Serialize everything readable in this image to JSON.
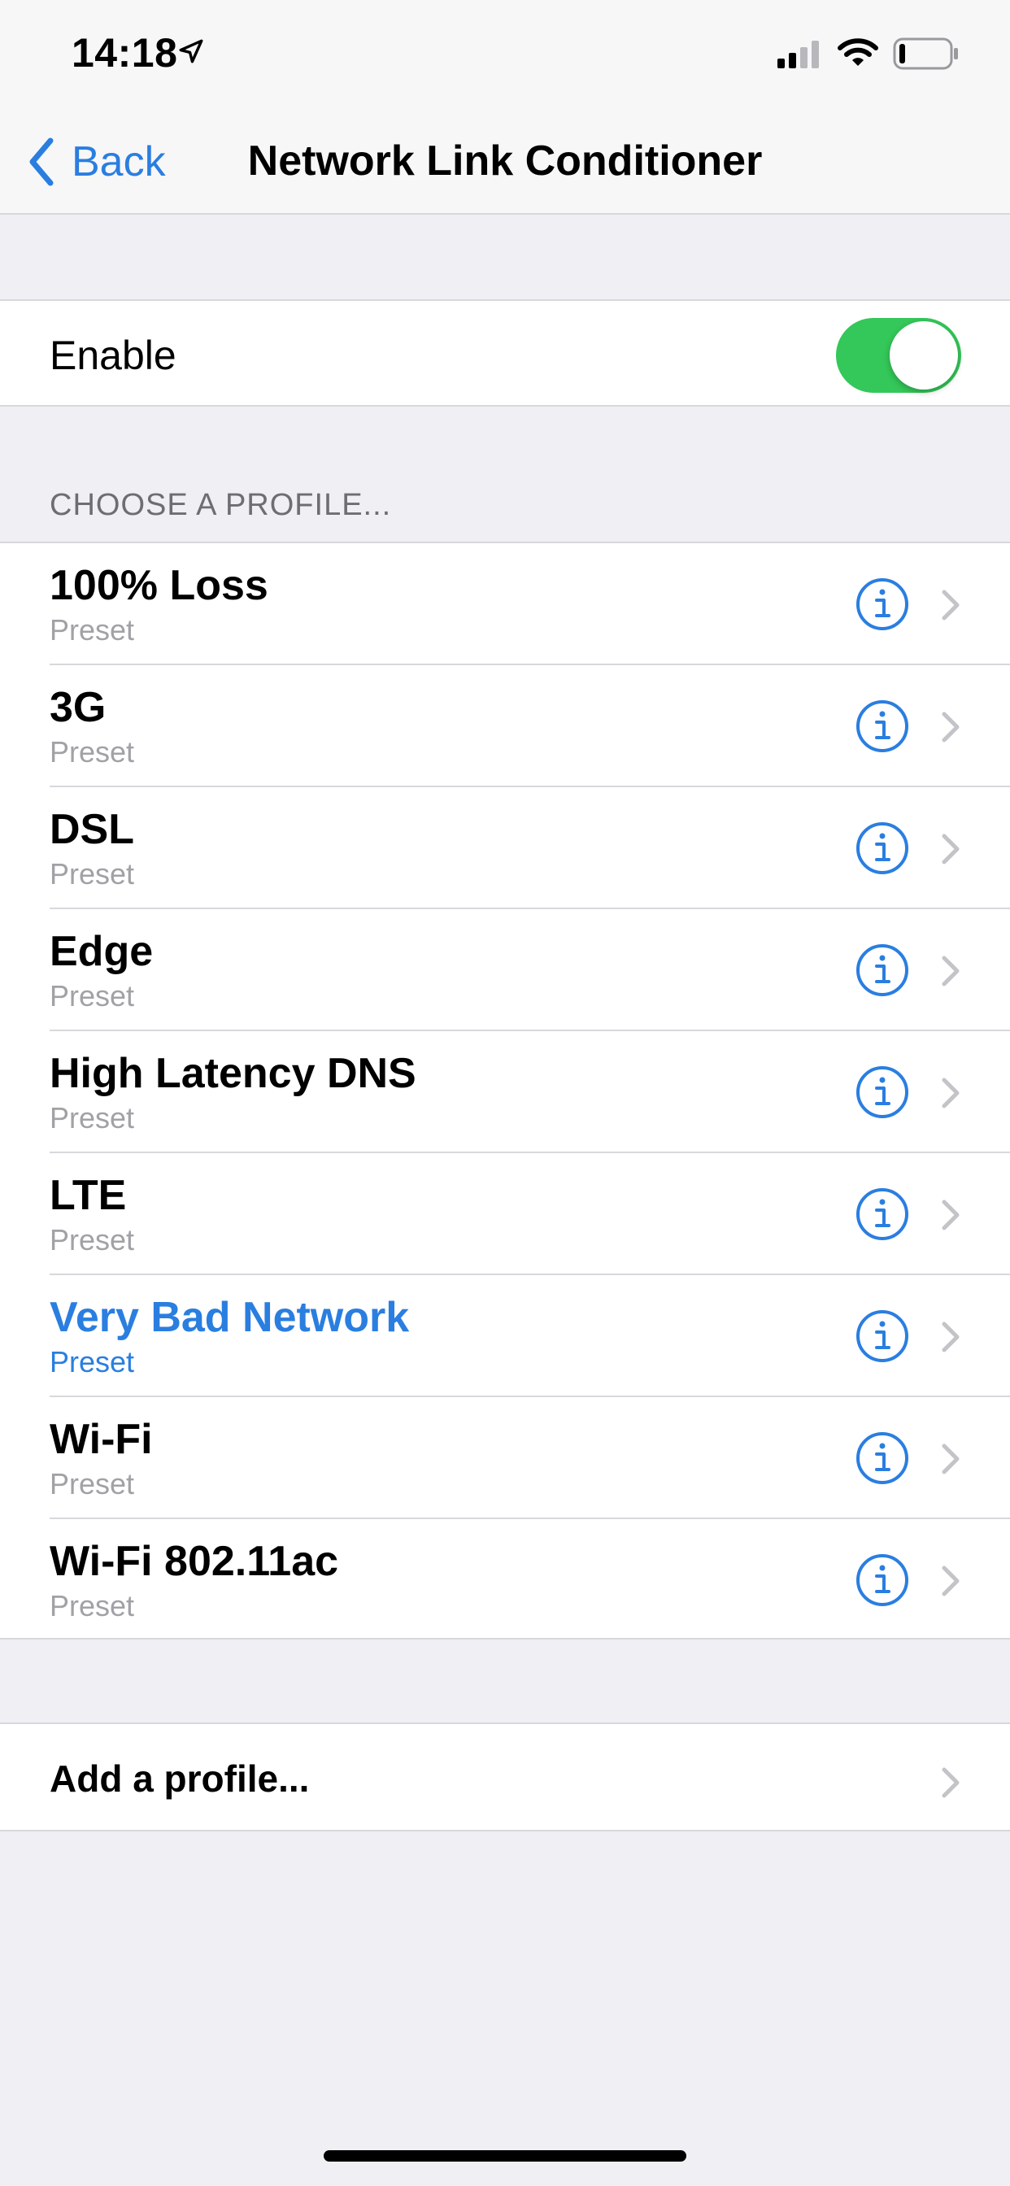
{
  "status_bar": {
    "time": "14:18",
    "icons": [
      "location-arrow-icon",
      "cellular-signal-icon",
      "wifi-icon",
      "battery-icon"
    ]
  },
  "nav": {
    "back_label": "Back",
    "title": "Network Link Conditioner"
  },
  "enable": {
    "label": "Enable",
    "on": true
  },
  "profiles": {
    "header": "CHOOSE A PROFILE...",
    "items": [
      {
        "name": "100% Loss",
        "subtitle": "Preset",
        "selected": false
      },
      {
        "name": "3G",
        "subtitle": "Preset",
        "selected": false
      },
      {
        "name": "DSL",
        "subtitle": "Preset",
        "selected": false
      },
      {
        "name": "Edge",
        "subtitle": "Preset",
        "selected": false
      },
      {
        "name": "High Latency DNS",
        "subtitle": "Preset",
        "selected": false
      },
      {
        "name": "LTE",
        "subtitle": "Preset",
        "selected": false
      },
      {
        "name": "Very Bad Network",
        "subtitle": "Preset",
        "selected": true
      },
      {
        "name": "Wi-Fi",
        "subtitle": "Preset",
        "selected": false
      },
      {
        "name": "Wi-Fi 802.11ac",
        "subtitle": "Preset",
        "selected": false
      }
    ]
  },
  "add_profile": {
    "label": "Add a profile..."
  },
  "colors": {
    "accent": "#2a7ee0",
    "toggle_on": "#34c759",
    "background": "#efeff4",
    "secondary_text": "#a1a1a6",
    "section_header": "#6d6d72"
  }
}
